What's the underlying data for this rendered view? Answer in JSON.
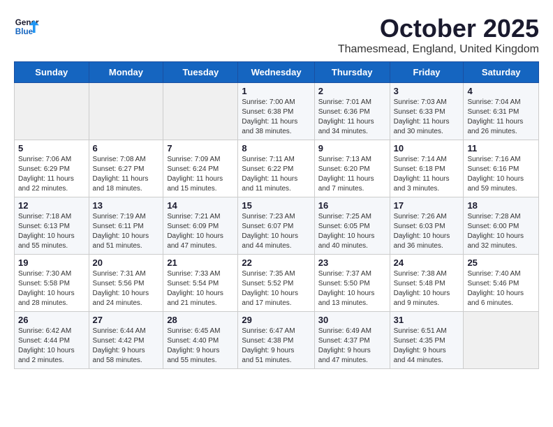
{
  "header": {
    "logo_general": "General",
    "logo_blue": "Blue",
    "month": "October 2025",
    "location": "Thamesmead, England, United Kingdom"
  },
  "weekdays": [
    "Sunday",
    "Monday",
    "Tuesday",
    "Wednesday",
    "Thursday",
    "Friday",
    "Saturday"
  ],
  "weeks": [
    [
      {
        "day": "",
        "info": ""
      },
      {
        "day": "",
        "info": ""
      },
      {
        "day": "",
        "info": ""
      },
      {
        "day": "1",
        "info": "Sunrise: 7:00 AM\nSunset: 6:38 PM\nDaylight: 11 hours\nand 38 minutes."
      },
      {
        "day": "2",
        "info": "Sunrise: 7:01 AM\nSunset: 6:36 PM\nDaylight: 11 hours\nand 34 minutes."
      },
      {
        "day": "3",
        "info": "Sunrise: 7:03 AM\nSunset: 6:33 PM\nDaylight: 11 hours\nand 30 minutes."
      },
      {
        "day": "4",
        "info": "Sunrise: 7:04 AM\nSunset: 6:31 PM\nDaylight: 11 hours\nand 26 minutes."
      }
    ],
    [
      {
        "day": "5",
        "info": "Sunrise: 7:06 AM\nSunset: 6:29 PM\nDaylight: 11 hours\nand 22 minutes."
      },
      {
        "day": "6",
        "info": "Sunrise: 7:08 AM\nSunset: 6:27 PM\nDaylight: 11 hours\nand 18 minutes."
      },
      {
        "day": "7",
        "info": "Sunrise: 7:09 AM\nSunset: 6:24 PM\nDaylight: 11 hours\nand 15 minutes."
      },
      {
        "day": "8",
        "info": "Sunrise: 7:11 AM\nSunset: 6:22 PM\nDaylight: 11 hours\nand 11 minutes."
      },
      {
        "day": "9",
        "info": "Sunrise: 7:13 AM\nSunset: 6:20 PM\nDaylight: 11 hours\nand 7 minutes."
      },
      {
        "day": "10",
        "info": "Sunrise: 7:14 AM\nSunset: 6:18 PM\nDaylight: 11 hours\nand 3 minutes."
      },
      {
        "day": "11",
        "info": "Sunrise: 7:16 AM\nSunset: 6:16 PM\nDaylight: 10 hours\nand 59 minutes."
      }
    ],
    [
      {
        "day": "12",
        "info": "Sunrise: 7:18 AM\nSunset: 6:13 PM\nDaylight: 10 hours\nand 55 minutes."
      },
      {
        "day": "13",
        "info": "Sunrise: 7:19 AM\nSunset: 6:11 PM\nDaylight: 10 hours\nand 51 minutes."
      },
      {
        "day": "14",
        "info": "Sunrise: 7:21 AM\nSunset: 6:09 PM\nDaylight: 10 hours\nand 47 minutes."
      },
      {
        "day": "15",
        "info": "Sunrise: 7:23 AM\nSunset: 6:07 PM\nDaylight: 10 hours\nand 44 minutes."
      },
      {
        "day": "16",
        "info": "Sunrise: 7:25 AM\nSunset: 6:05 PM\nDaylight: 10 hours\nand 40 minutes."
      },
      {
        "day": "17",
        "info": "Sunrise: 7:26 AM\nSunset: 6:03 PM\nDaylight: 10 hours\nand 36 minutes."
      },
      {
        "day": "18",
        "info": "Sunrise: 7:28 AM\nSunset: 6:00 PM\nDaylight: 10 hours\nand 32 minutes."
      }
    ],
    [
      {
        "day": "19",
        "info": "Sunrise: 7:30 AM\nSunset: 5:58 PM\nDaylight: 10 hours\nand 28 minutes."
      },
      {
        "day": "20",
        "info": "Sunrise: 7:31 AM\nSunset: 5:56 PM\nDaylight: 10 hours\nand 24 minutes."
      },
      {
        "day": "21",
        "info": "Sunrise: 7:33 AM\nSunset: 5:54 PM\nDaylight: 10 hours\nand 21 minutes."
      },
      {
        "day": "22",
        "info": "Sunrise: 7:35 AM\nSunset: 5:52 PM\nDaylight: 10 hours\nand 17 minutes."
      },
      {
        "day": "23",
        "info": "Sunrise: 7:37 AM\nSunset: 5:50 PM\nDaylight: 10 hours\nand 13 minutes."
      },
      {
        "day": "24",
        "info": "Sunrise: 7:38 AM\nSunset: 5:48 PM\nDaylight: 10 hours\nand 9 minutes."
      },
      {
        "day": "25",
        "info": "Sunrise: 7:40 AM\nSunset: 5:46 PM\nDaylight: 10 hours\nand 6 minutes."
      }
    ],
    [
      {
        "day": "26",
        "info": "Sunrise: 6:42 AM\nSunset: 4:44 PM\nDaylight: 10 hours\nand 2 minutes."
      },
      {
        "day": "27",
        "info": "Sunrise: 6:44 AM\nSunset: 4:42 PM\nDaylight: 9 hours\nand 58 minutes."
      },
      {
        "day": "28",
        "info": "Sunrise: 6:45 AM\nSunset: 4:40 PM\nDaylight: 9 hours\nand 55 minutes."
      },
      {
        "day": "29",
        "info": "Sunrise: 6:47 AM\nSunset: 4:38 PM\nDaylight: 9 hours\nand 51 minutes."
      },
      {
        "day": "30",
        "info": "Sunrise: 6:49 AM\nSunset: 4:37 PM\nDaylight: 9 hours\nand 47 minutes."
      },
      {
        "day": "31",
        "info": "Sunrise: 6:51 AM\nSunset: 4:35 PM\nDaylight: 9 hours\nand 44 minutes."
      },
      {
        "day": "",
        "info": ""
      }
    ]
  ]
}
